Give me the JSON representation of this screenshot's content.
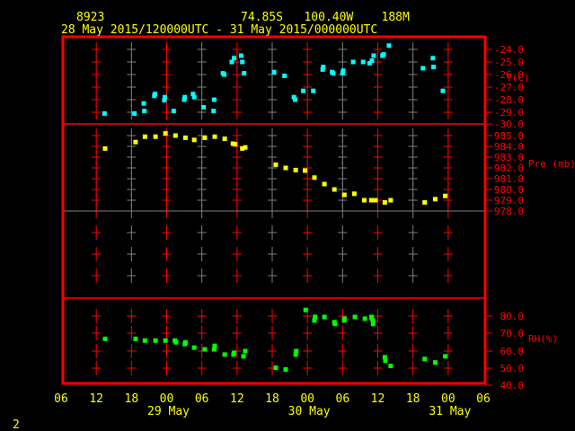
{
  "header": {
    "station": "8923",
    "location": "74.85S   100.40W    188M",
    "period": "28 May 2015/120000UTC - 31 May 2015/000000UTC"
  },
  "footer": {
    "frame_number": "2"
  },
  "colors": {
    "frame": "#ff0000",
    "temperature": "#00ffff",
    "pressure": "#ffff00",
    "rh": "#00ff00",
    "grid_alt": "#808080"
  },
  "chart_data": [
    {
      "type": "scatter",
      "title": "Temperature",
      "ylabel": "T(C)",
      "x_units": "hours since 28 May 06 UTC",
      "xlim": [
        0,
        72
      ],
      "ylim": [
        -30,
        -24
      ],
      "ytick_labels": [
        "-24.0",
        "-25.0",
        "-26.0",
        "-27.0",
        "-28.0",
        "-29.0",
        "-30.0"
      ],
      "x": [
        7.4,
        12.5,
        14.1,
        14.2,
        15.9,
        16.0,
        17.6,
        17.7,
        19.2,
        21.0,
        21.1,
        22.5,
        22.7,
        24.3,
        26.0,
        26.1,
        27.6,
        27.8,
        29.1,
        29.5,
        30.7,
        30.9,
        31.2,
        36.3,
        38.1,
        39.7,
        39.9,
        41.3,
        43.0,
        44.6,
        44.7,
        46.2,
        46.4,
        48.0,
        48.1,
        49.8,
        51.5,
        52.6,
        53.0,
        53.3,
        54.8,
        55.0,
        55.9,
        61.7,
        63.4,
        63.5,
        65.1
      ],
      "y": [
        -29.1,
        -29.1,
        -28.3,
        -28.9,
        -27.7,
        -27.55,
        -28.05,
        -27.8,
        -28.9,
        -28.0,
        -27.8,
        -27.55,
        -27.8,
        -28.6,
        -28.9,
        -28.0,
        -25.9,
        -26.0,
        -25.0,
        -24.7,
        -24.5,
        -25.0,
        -25.9,
        -25.8,
        -26.1,
        -27.8,
        -28.0,
        -27.3,
        -27.3,
        -25.6,
        -25.4,
        -25.8,
        -25.9,
        -25.9,
        -25.7,
        -25.0,
        -25.0,
        -25.1,
        -24.9,
        -24.5,
        -24.5,
        -24.4,
        -23.7,
        -25.5,
        -24.7,
        -25.4,
        -27.3
      ]
    },
    {
      "type": "scatter",
      "title": "Pressure",
      "ylabel": "Pre (mb)",
      "x_units": "hours since 28 May 06 UTC",
      "xlim": [
        0,
        72
      ],
      "ylim": [
        978,
        986
      ],
      "ytick_labels": [
        "985.0",
        "984.0",
        "983.0",
        "982.0",
        "981.0",
        "980.0",
        "979.0",
        "978.0"
      ],
      "x": [
        7.5,
        12.7,
        14.3,
        16.1,
        17.8,
        19.5,
        21.2,
        22.7,
        24.5,
        26.2,
        27.9,
        29.3,
        29.7,
        30.9,
        31.4,
        36.6,
        38.3,
        40.0,
        41.6,
        43.2,
        44.9,
        46.6,
        48.3,
        50.0,
        51.7,
        52.9,
        53.6,
        55.2,
        56.2,
        62.0,
        63.8,
        65.5
      ],
      "y": [
        983.8,
        984.4,
        984.9,
        984.9,
        985.2,
        985.0,
        984.8,
        984.6,
        984.8,
        984.9,
        984.7,
        984.25,
        984.2,
        983.8,
        983.9,
        982.3,
        982.0,
        981.8,
        981.75,
        981.1,
        980.5,
        980.0,
        979.5,
        979.6,
        979.0,
        979.0,
        979.0,
        978.8,
        979.0,
        978.8,
        979.1,
        979.4
      ]
    },
    {
      "type": "scatter",
      "title": "Relative Humidity",
      "ylabel": "RH(%)",
      "x_units": "hours since 28 May 06 UTC",
      "xlim": [
        0,
        72
      ],
      "ylim": [
        40,
        90
      ],
      "ytick_labels": [
        "80.0",
        "70.0",
        "60.0",
        "50.0",
        "40.0"
      ],
      "x": [
        7.5,
        12.7,
        14.3,
        16.1,
        17.8,
        19.4,
        19.6,
        21.2,
        21.1,
        22.7,
        24.5,
        26.2,
        26.1,
        27.9,
        29.4,
        29.5,
        31.1,
        31.4,
        36.6,
        38.3,
        40.0,
        40.1,
        41.7,
        43.3,
        43.2,
        44.9,
        46.6,
        46.7,
        48.3,
        48.3,
        50.1,
        51.8,
        52.9,
        53.0,
        53.2,
        53.2,
        55.2,
        55.3,
        56.2,
        62.0,
        63.8,
        65.5
      ],
      "y": [
        67,
        67,
        66,
        66,
        66,
        66,
        65,
        64.9,
        64,
        62,
        61,
        63,
        61,
        58,
        58,
        59,
        57,
        60,
        50.5,
        49.5,
        58,
        60,
        83.5,
        79.5,
        77.5,
        79.5,
        76.5,
        75.5,
        78.5,
        77.5,
        79.5,
        78.5,
        79.5,
        78.5,
        77.5,
        75.5,
        56.5,
        54.5,
        51.5,
        55.5,
        53.5,
        57
      ]
    }
  ],
  "time_axis": {
    "hour_labels": [
      "06",
      "12",
      "18",
      "00",
      "06",
      "12",
      "18",
      "00",
      "06",
      "12",
      "18",
      "00",
      "06"
    ],
    "date_labels": [
      "29 May",
      "30 May",
      "31 May"
    ]
  }
}
